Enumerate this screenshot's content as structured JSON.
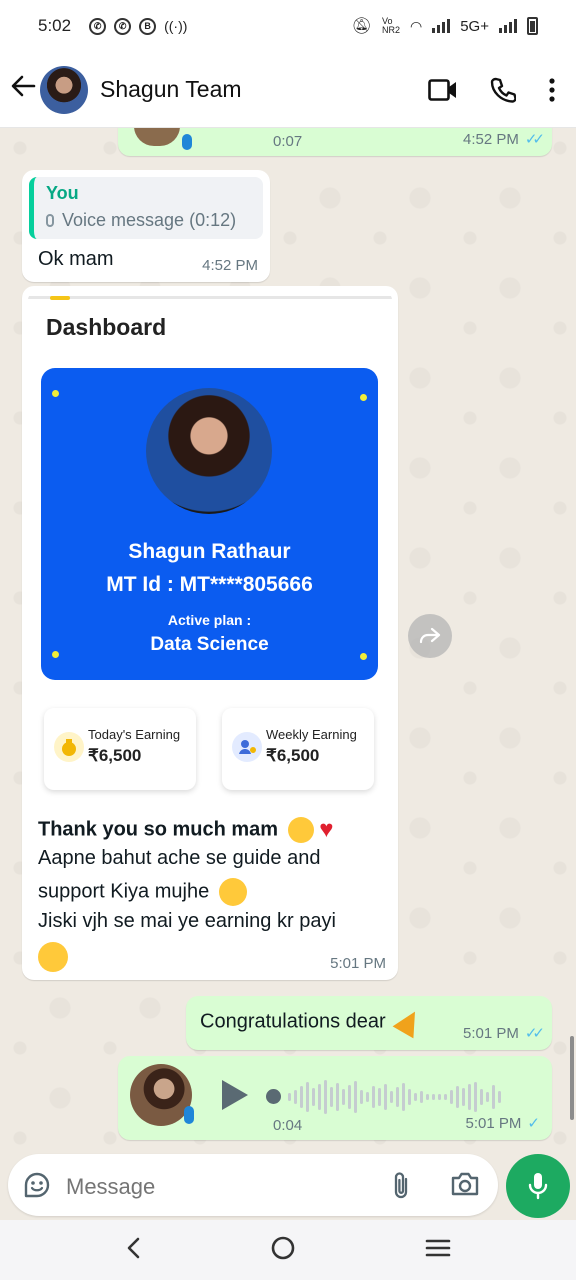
{
  "status_bar": {
    "time": "5:02",
    "network": "5G+",
    "vo_label": "Vo\nNR2"
  },
  "header": {
    "contact_name": "Shagun Team"
  },
  "messages": {
    "voice_top": {
      "duration": "0:07",
      "time": "4:52 PM"
    },
    "reply_ok": {
      "quote_author": "You",
      "quote_text": "Voice message (0:12)",
      "text": "Ok mam",
      "time": "4:52 PM"
    },
    "image_caption": {
      "dashboard_title": "Dashboard",
      "card_name": "Shagun Rathaur",
      "card_id": "MT Id :  MT****805666",
      "plan_label": "Active plan :",
      "plan_value": "Data Science",
      "today_label": "Today's Earning",
      "today_value": "₹6,500",
      "weekly_label": "Weekly Earning",
      "weekly_value": "₹6,500",
      "line1": "Thank you so much mam",
      "line2": "Aapne bahut ache se guide and",
      "line3": "support Kiya mujhe",
      "line4": "Jiski vjh se mai ye earning kr payi",
      "time": "5:01 PM"
    },
    "congrats": {
      "text": "Congratulations dear",
      "time": "5:01 PM"
    },
    "voice_bottom": {
      "duration": "0:04",
      "time": "5:01 PM"
    }
  },
  "composer": {
    "placeholder": "Message"
  },
  "colors": {
    "accent_green": "#1daa61",
    "outgoing_bubble": "#d9fdd3",
    "read_ticks": "#53bdeb",
    "card_blue": "#0b5cf0"
  }
}
